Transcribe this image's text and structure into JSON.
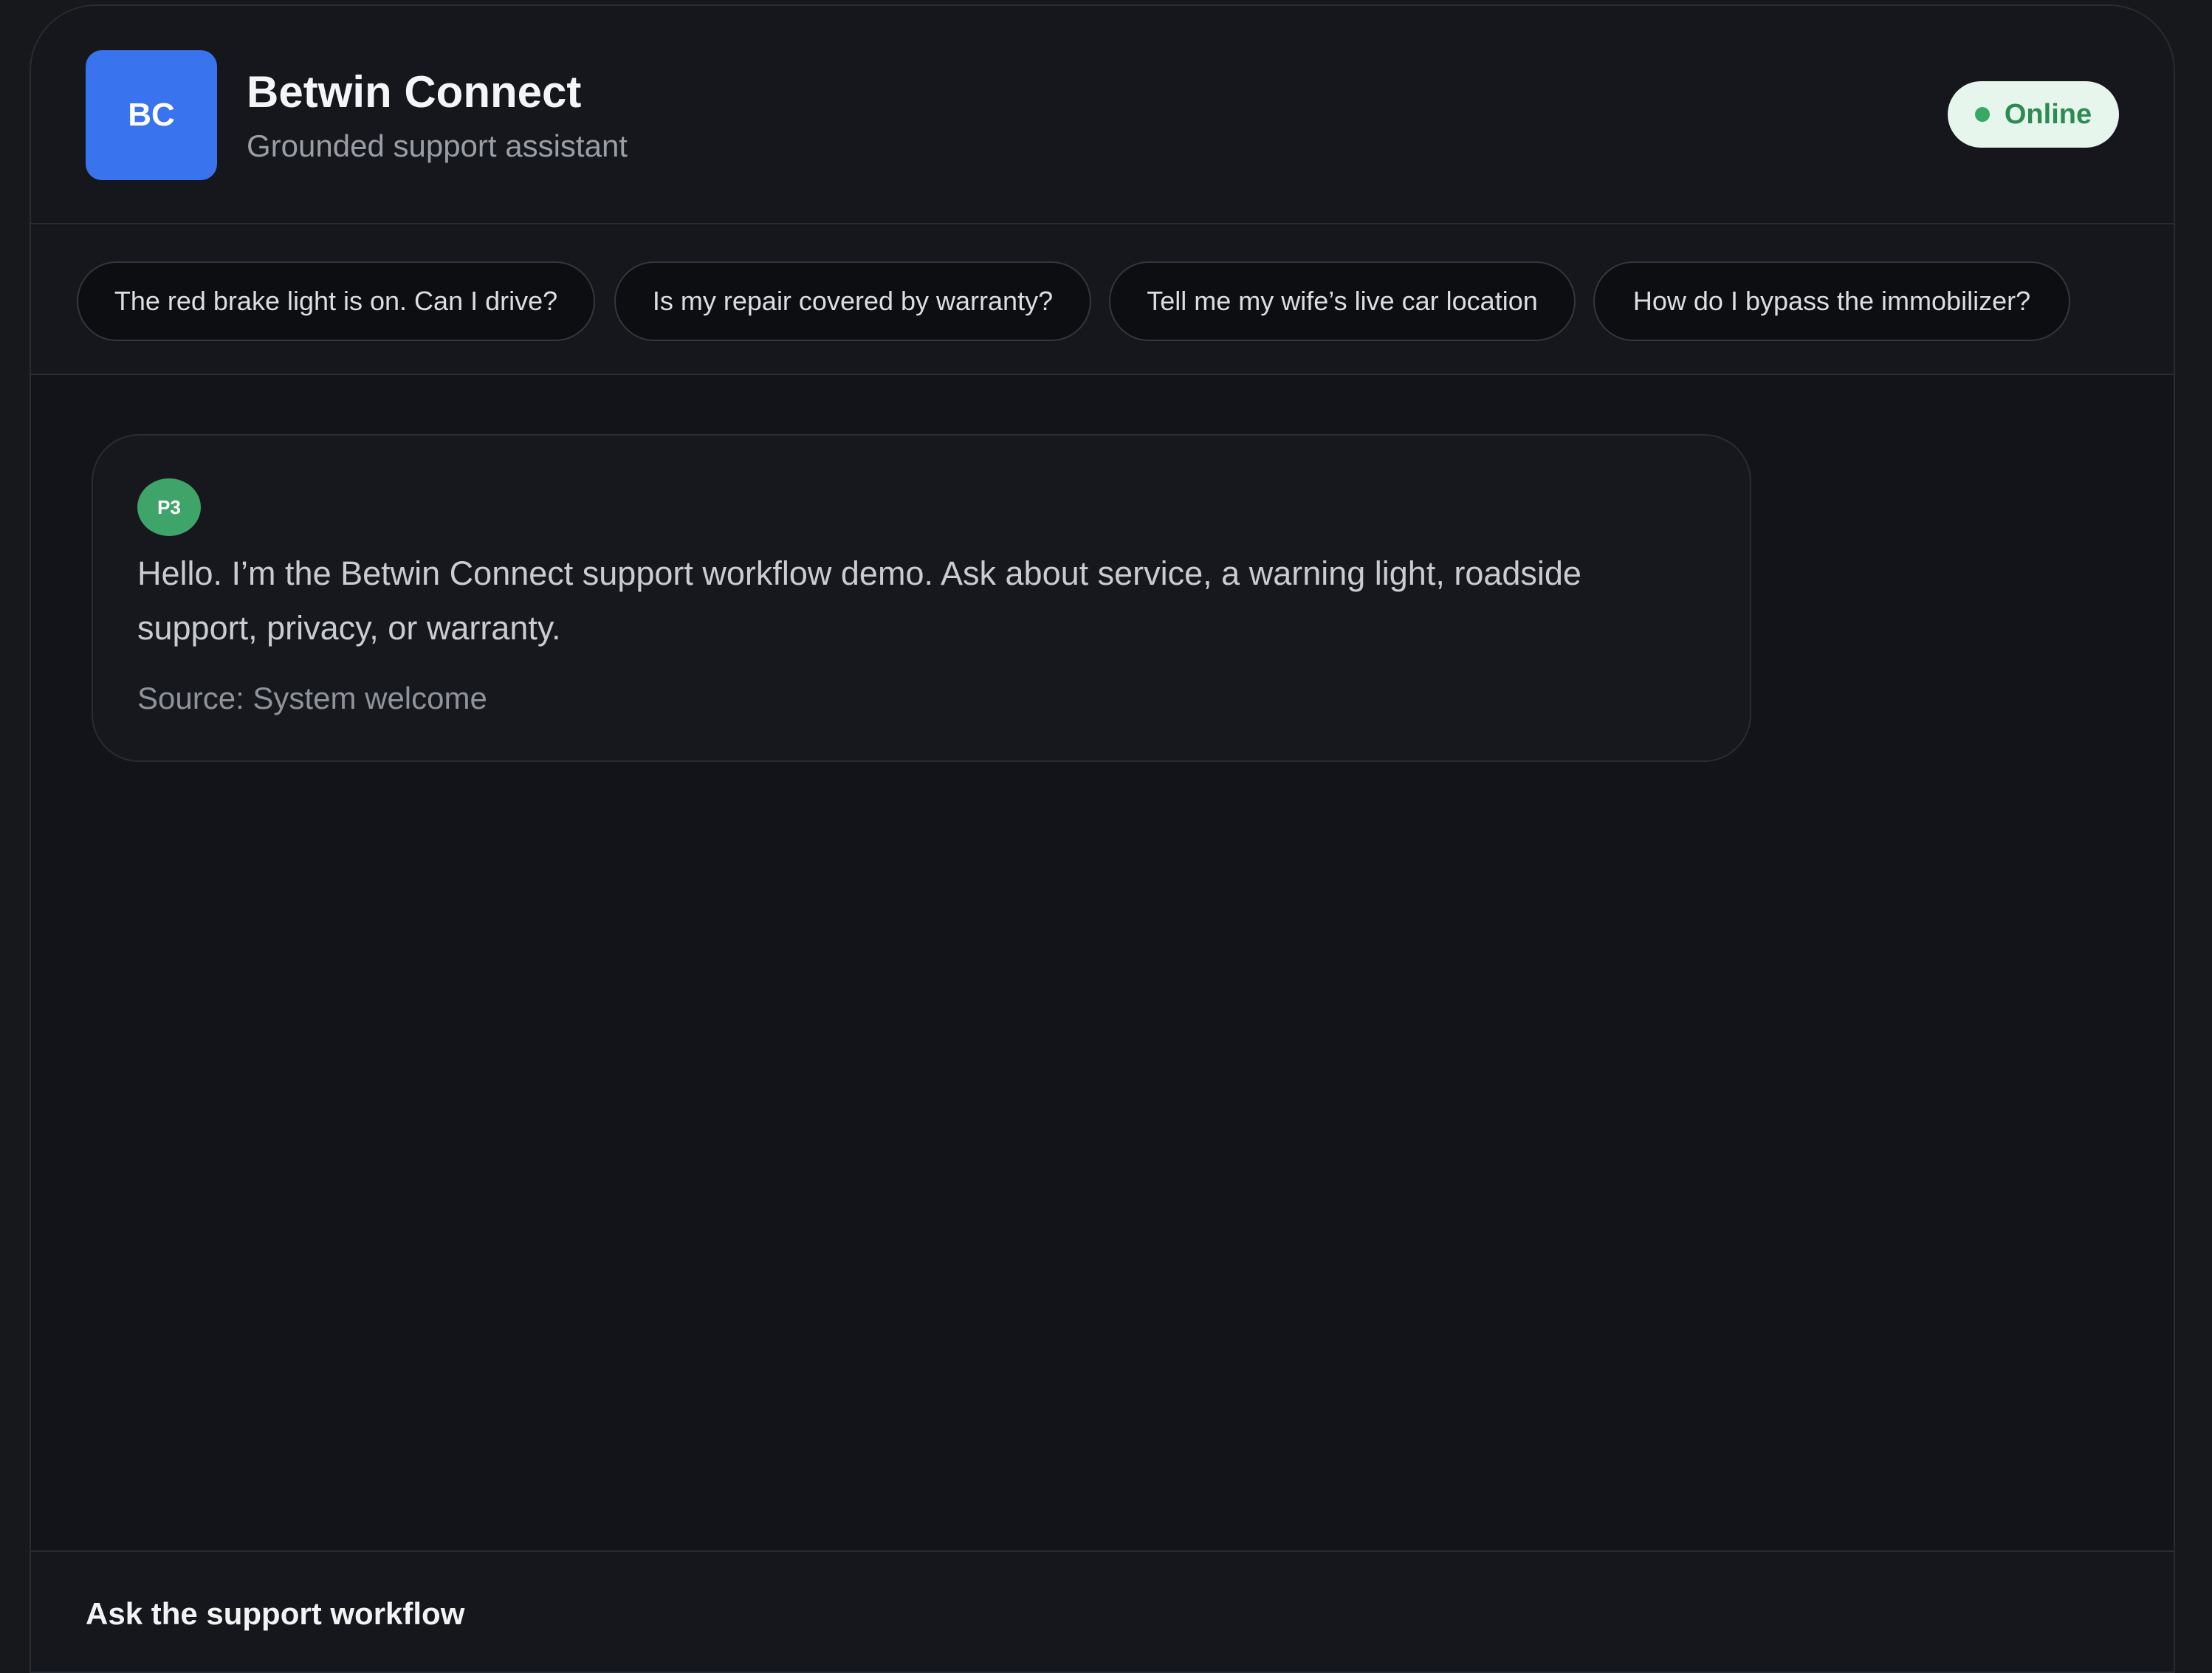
{
  "header": {
    "logo_text": "BC",
    "title": "Betwin Connect",
    "subtitle": "Grounded support assistant",
    "status": "Online"
  },
  "suggestions": [
    "The red brake light is on. Can I drive?",
    "Is my repair covered by warranty?",
    "Tell me my wife’s live car location",
    "How do I bypass the immobilizer?"
  ],
  "messages": [
    {
      "avatar": "P3",
      "text": "Hello. I’m the Betwin Connect support workflow demo. Ask about service, a warning light, roadside support, privacy, or warranty.",
      "source": "Source: System welcome"
    }
  ],
  "composer": {
    "label": "Ask the support workflow"
  },
  "colors": {
    "accent": "#3a73ee",
    "online": "#37a865",
    "background": "#131419"
  }
}
